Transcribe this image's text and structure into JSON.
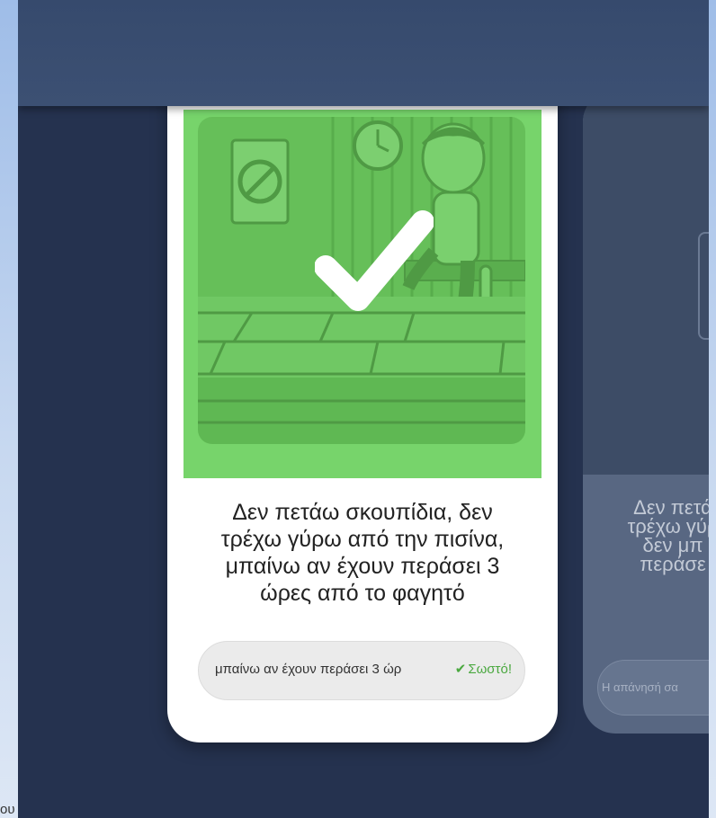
{
  "quiz_card": {
    "question_text": "Δεν πετάω σκουπίδια, δεν\nτρέχω γύρω από την πισίνα,\nμπαίνω αν έχουν περάσει 3\nώρες από το φαγητό",
    "answer_value": "μπαίνω αν έχουν περάσει 3 ώρ",
    "status_label": "Σωστό!",
    "status_icon": "check-icon",
    "image_overlay_icon": "large-checkmark-icon"
  },
  "next_card": {
    "question_text": "Δεν πετά\nτρέχω γύρ\nδεν μπ\nπεράσε",
    "answer_placeholder": "Η απάνησή σα"
  },
  "stray_text": "ου",
  "colors": {
    "app_background": "#25324f",
    "top_bar": "#3a4e70",
    "correct_green": "#4aa83f",
    "image_green": "#77d46b"
  }
}
